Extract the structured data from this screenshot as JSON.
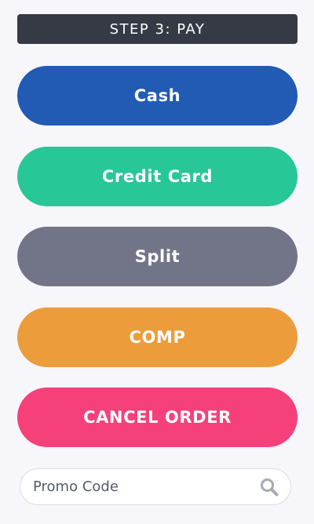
{
  "header": {
    "title": "STEP 3: PAY"
  },
  "payment_options": [
    {
      "label": "Cash",
      "color": "#215bb4"
    },
    {
      "label": "Credit Card",
      "color": "#28c797"
    },
    {
      "label": "Split",
      "color": "#727588"
    },
    {
      "label": "COMP",
      "color": "#ec9c3b"
    },
    {
      "label": "CANCEL ORDER",
      "color": "#f5407a"
    }
  ],
  "promo": {
    "placeholder": "Promo Code",
    "value": "",
    "icon": "search-icon",
    "icon_color": "#a6a9b1"
  },
  "colors": {
    "background": "#f6f6fb",
    "header_bg": "#353a45"
  }
}
